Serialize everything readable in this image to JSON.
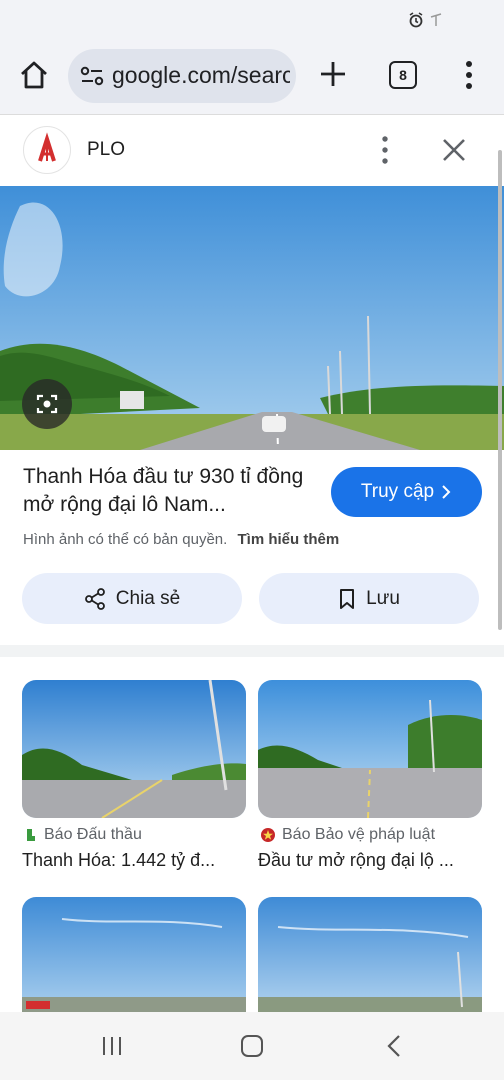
{
  "browser": {
    "url": "google.com/search",
    "tab_count": "8"
  },
  "source": {
    "name": "PLO"
  },
  "detail": {
    "title": "Thanh Hóa đầu tư 930 tỉ đồng mở rộng đại lô Nam...",
    "visit_label": "Truy cập",
    "copyright_note": "Hình ảnh có thể có bản quyền.",
    "learn_more": "Tìm hiểu thêm",
    "share_label": "Chia sẻ",
    "save_label": "Lưu"
  },
  "related": [
    {
      "source": "Báo Đấu thầu",
      "title": "Thanh Hóa: 1.442 tỷ đ..."
    },
    {
      "source": "Báo Bảo vệ pháp luật",
      "title": "Đầu tư mở rộng đại lộ ..."
    },
    {
      "source": "",
      "title": ""
    },
    {
      "source": "",
      "title": ""
    }
  ],
  "icons": {
    "home": "home-icon",
    "url_options": "tune-icon",
    "new_tab": "plus-icon",
    "menu": "more-vert-icon",
    "close": "close-icon",
    "lens": "lens-icon",
    "share": "share-icon",
    "save": "bookmark-icon"
  },
  "colors": {
    "accent": "#1a73e8",
    "pill": "#e8eefb",
    "chrome": "#f2f3f7"
  }
}
